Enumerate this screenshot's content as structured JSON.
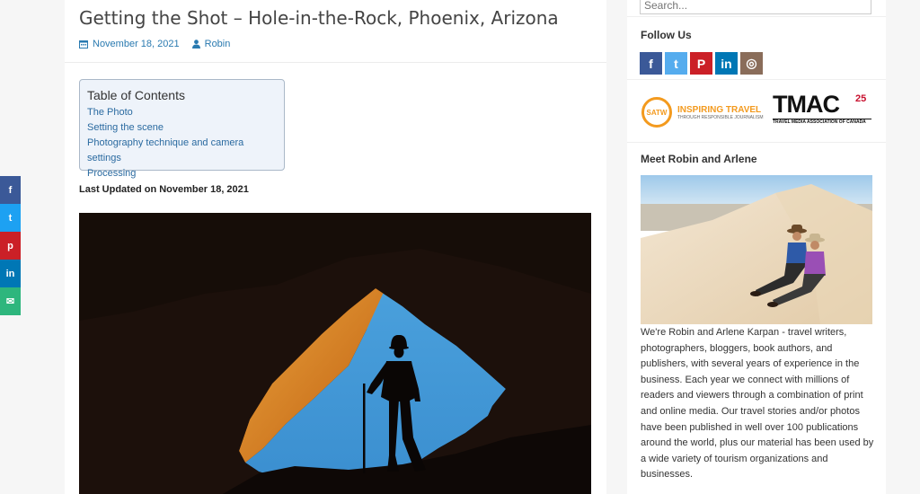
{
  "article": {
    "title": "Getting the Shot – Hole-in-the-Rock, Phoenix, Arizona",
    "date": "November 18, 2021",
    "author": "Robin",
    "last_updated": "Last Updated on November 18, 2021"
  },
  "toc": {
    "title": "Table of Contents",
    "items": [
      "The Photo",
      "Setting the scene",
      "Photography technique and camera settings",
      "Processing"
    ]
  },
  "share_bar": {
    "items": [
      {
        "icon": "facebook-icon",
        "glyph": "f",
        "color": "#3b5998"
      },
      {
        "icon": "twitter-icon",
        "glyph": "t",
        "color": "#1da1f2"
      },
      {
        "icon": "pinterest-icon",
        "glyph": "p",
        "color": "#cb2027"
      },
      {
        "icon": "linkedin-icon",
        "glyph": "in",
        "color": "#0077b5"
      },
      {
        "icon": "email-icon",
        "glyph": "✉",
        "color": "#2eb67d"
      }
    ]
  },
  "sidebar": {
    "search_placeholder": "Search...",
    "follow_title": "Follow Us",
    "social": [
      {
        "icon": "facebook-icon",
        "glyph": "f",
        "color": "#3b5998"
      },
      {
        "icon": "twitter-icon",
        "glyph": "t",
        "color": "#55acee"
      },
      {
        "icon": "pinterest-icon",
        "glyph": "P",
        "color": "#cb2027"
      },
      {
        "icon": "linkedin-icon",
        "glyph": "in",
        "color": "#0077b5"
      },
      {
        "icon": "instagram-icon",
        "glyph": "◎",
        "color": "#8a6d5a"
      }
    ],
    "satw": {
      "badge": "SATW",
      "line1": "INSPIRING TRAVEL",
      "line2": "THROUGH RESPONSIBLE JOURNALISM"
    },
    "tmac": {
      "name": "TMAC",
      "years": "25",
      "subtitle": "TRAVEL MEDIA ASSOCIATION OF CANADA"
    },
    "meet_title": "Meet Robin and Arlene",
    "bio": "We're Robin and Arlene Karpan - travel writers, photographers, bloggers, book authors, and publishers, with several years of experience in the business. Each year we connect with millions of readers and viewers through a combination of print and online media. Our travel stories and/or photos have been published in well over 100 publications around the world, plus our material has been used by a wide variety of tourism organizations and businesses."
  }
}
